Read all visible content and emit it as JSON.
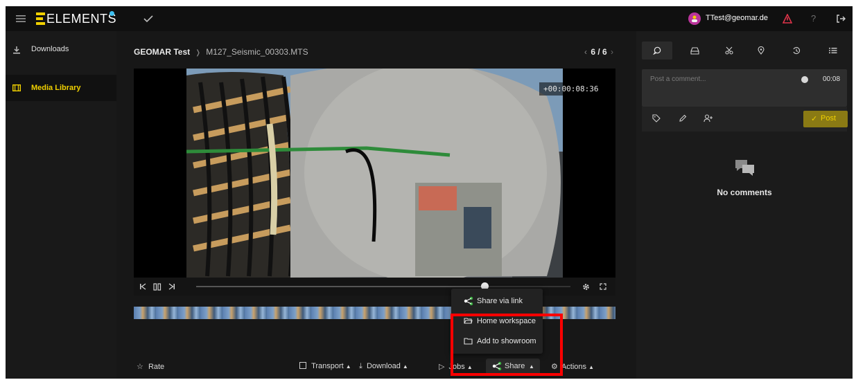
{
  "topbar": {
    "logo_text": "ELEMENTS",
    "user": "TTest@geomar.de"
  },
  "sidebar": {
    "items": [
      {
        "label": "Downloads",
        "active": false
      },
      {
        "label": "Media Library",
        "active": true
      }
    ]
  },
  "breadcrumb": {
    "root": "GEOMAR Test",
    "separator": "❭",
    "file": "M127_Seismic_00303.MTS",
    "pager": "6 / 6"
  },
  "video": {
    "timecode": "+00:00:08:36",
    "progress": 0.77
  },
  "bottom_bar": {
    "rate": "Rate",
    "transport": "Transport",
    "download": "Download",
    "jobs": "Jobs",
    "share": "Share",
    "actions": "Actions"
  },
  "share_menu": {
    "items": [
      "Share via link",
      "Home workspace",
      "Add to showroom"
    ]
  },
  "comments": {
    "placeholder": "Post a comment...",
    "time": "00:08",
    "post": "Post",
    "empty": "No comments"
  },
  "colors": {
    "accent": "#f0d000",
    "highlight": "#ff0000",
    "share_green": "#3cb043"
  }
}
